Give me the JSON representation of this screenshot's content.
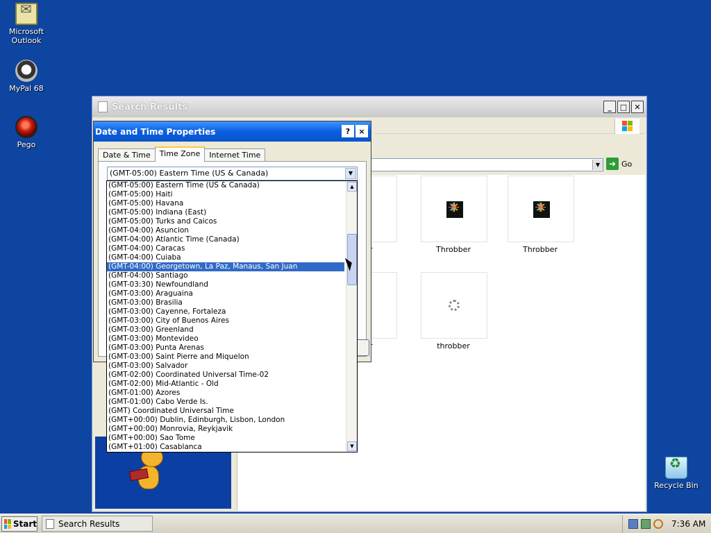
{
  "desktop": {
    "icons": [
      {
        "label": "Microsoft Outlook"
      },
      {
        "label": "MyPal 68"
      },
      {
        "label": "Pego"
      },
      {
        "label": "Recycle Bin"
      }
    ]
  },
  "search_window": {
    "title": "Search Results",
    "go_label": "Go",
    "thumbnails": [
      {
        "label": "bber"
      },
      {
        "label": "Throbber"
      },
      {
        "label": "Throbber"
      },
      {
        "label": "bber"
      },
      {
        "label": "throbber"
      }
    ]
  },
  "dialog": {
    "title": "Date and Time Properties",
    "help": "?",
    "close": "×",
    "tabs": [
      {
        "label": "Date & Time"
      },
      {
        "label": "Time Zone"
      },
      {
        "label": "Internet Time"
      }
    ],
    "selected_timezone": "(GMT-05:00) Eastern Time (US & Canada)"
  },
  "timezone_list": {
    "items": [
      "(GMT-05:00) Eastern Time (US & Canada)",
      "(GMT-05:00) Haiti",
      "(GMT-05:00) Havana",
      "(GMT-05:00) Indiana (East)",
      "(GMT-05:00) Turks and Caicos",
      "(GMT-04:00) Asuncion",
      "(GMT-04:00) Atlantic Time (Canada)",
      "(GMT-04:00) Caracas",
      "(GMT-04:00) Cuiaba",
      "(GMT-04:00) Georgetown, La Paz, Manaus, San Juan",
      "(GMT-04:00) Santiago",
      "(GMT-03:30) Newfoundland",
      "(GMT-03:00) Araguaina",
      "(GMT-03:00) Brasilia",
      "(GMT-03:00) Cayenne, Fortaleza",
      "(GMT-03:00) City of Buenos Aires",
      "(GMT-03:00) Greenland",
      "(GMT-03:00) Montevideo",
      "(GMT-03:00) Punta Arenas",
      "(GMT-03:00) Saint Pierre and Miquelon",
      "(GMT-03:00) Salvador",
      "(GMT-02:00) Coordinated Universal Time-02",
      "(GMT-02:00) Mid-Atlantic - Old",
      "(GMT-01:00) Azores",
      "(GMT-01:00) Cabo Verde Is.",
      "(GMT) Coordinated Universal Time",
      "(GMT+00:00) Dublin, Edinburgh, Lisbon, London",
      "(GMT+00:00) Monrovia, Reykjavik",
      "(GMT+00:00) Sao Tome",
      "(GMT+01:00) Casablanca"
    ],
    "selected_index": 9
  },
  "taskbar": {
    "start_label": "Start",
    "task_label": "Search Results",
    "clock": "7:36 AM"
  },
  "colors": {
    "desktop": "#0e45a0",
    "selection": "#316ac5",
    "dialog_titlebar": "#0a5fe0"
  }
}
